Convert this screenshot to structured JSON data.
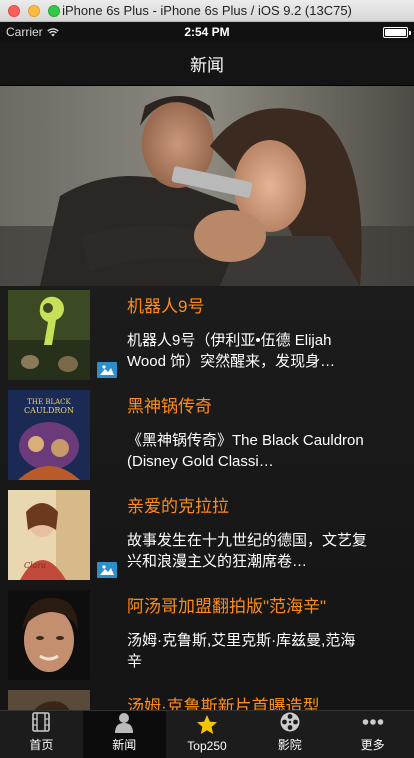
{
  "window": {
    "title": "iPhone 6s Plus - iPhone 6s Plus / iOS 9.2 (13C75)"
  },
  "status_bar": {
    "carrier": "Carrier",
    "time": "2:54 PM"
  },
  "nav": {
    "title": "新闻"
  },
  "news": [
    {
      "title": "机器人9号",
      "desc": "机器人9号（伊利亚•伍德 Elijah Wood 饰）突然醒来，发现身…",
      "has_image_badge": true
    },
    {
      "title": "黑神锅传奇",
      "desc": "《黑神锅传奇》The Black Cauldron (Disney Gold Classi…",
      "has_image_badge": false
    },
    {
      "title": "亲爱的克拉拉",
      "desc": "故事发生在十九世纪的德国，文艺复兴和浪漫主义的狂潮席卷…",
      "has_image_badge": true
    },
    {
      "title": "阿汤哥加盟翻拍版\"范海辛\"",
      "desc": "汤姆·克鲁斯,艾里克斯·库兹曼,范海辛",
      "has_image_badge": false
    },
    {
      "title": "汤姆·克鲁斯新片首曝造型",
      "desc": "",
      "has_image_badge": false
    }
  ],
  "tabs": [
    {
      "label": "首页",
      "icon": "film-icon",
      "active": false
    },
    {
      "label": "新闻",
      "icon": "person-icon",
      "active": true
    },
    {
      "label": "Top250",
      "icon": "star-icon",
      "active": false
    },
    {
      "label": "影院",
      "icon": "film-reel-icon",
      "active": false
    },
    {
      "label": "更多",
      "icon": "more-dots-icon",
      "active": false
    }
  ],
  "colors": {
    "accent": "#ff8c1a",
    "badge": "#2c8fc9",
    "star": "#f5c400"
  }
}
